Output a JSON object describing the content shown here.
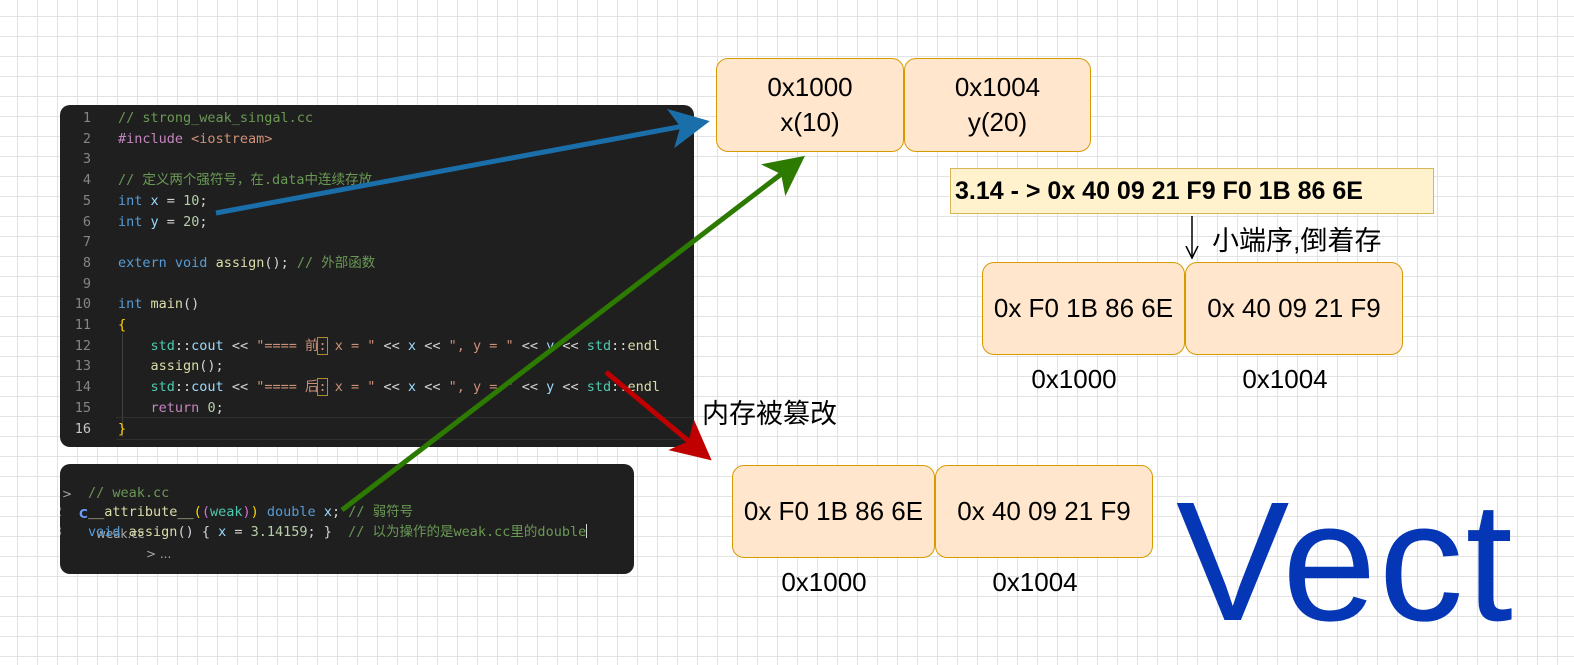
{
  "editor": {
    "lines": [
      {
        "n": "1",
        "tokens": [
          {
            "t": "// strong_weak_singal.cc",
            "c": "comment"
          }
        ]
      },
      {
        "n": "2",
        "tokens": [
          {
            "t": "#include ",
            "c": "pre"
          },
          {
            "t": "<iostream>",
            "c": "str"
          }
        ]
      },
      {
        "n": "3",
        "tokens": []
      },
      {
        "n": "4",
        "tokens": [
          {
            "t": "// 定义两个强符号，在.data中连续存放",
            "c": "comment"
          }
        ]
      },
      {
        "n": "5",
        "tokens": [
          {
            "t": "int",
            "c": "kw"
          },
          {
            "t": " ",
            "c": "punct"
          },
          {
            "t": "x",
            "c": "var"
          },
          {
            "t": " = ",
            "c": "punct"
          },
          {
            "t": "10",
            "c": "num"
          },
          {
            "t": ";",
            "c": "punct"
          }
        ]
      },
      {
        "n": "6",
        "tokens": [
          {
            "t": "int",
            "c": "kw"
          },
          {
            "t": " ",
            "c": "punct"
          },
          {
            "t": "y",
            "c": "var"
          },
          {
            "t": " = ",
            "c": "punct"
          },
          {
            "t": "20",
            "c": "num"
          },
          {
            "t": ";",
            "c": "punct"
          }
        ]
      },
      {
        "n": "7",
        "tokens": []
      },
      {
        "n": "8",
        "tokens": [
          {
            "t": "extern",
            "c": "kw"
          },
          {
            "t": " ",
            "c": "punct"
          },
          {
            "t": "void",
            "c": "kw"
          },
          {
            "t": " ",
            "c": "punct"
          },
          {
            "t": "assign",
            "c": "fn"
          },
          {
            "t": "();",
            "c": "punct"
          },
          {
            "t": " // 外部函数",
            "c": "comment"
          }
        ]
      },
      {
        "n": "9",
        "tokens": []
      },
      {
        "n": "10",
        "tokens": [
          {
            "t": "int",
            "c": "kw"
          },
          {
            "t": " ",
            "c": "punct"
          },
          {
            "t": "main",
            "c": "fn"
          },
          {
            "t": "()",
            "c": "punct"
          }
        ]
      },
      {
        "n": "11",
        "tokens": [
          {
            "t": "{",
            "c": "brace"
          }
        ]
      },
      {
        "n": "12",
        "tokens": [
          {
            "t": "    ",
            "c": "punct"
          },
          {
            "t": "std",
            "c": "ns"
          },
          {
            "t": "::",
            "c": "punct"
          },
          {
            "t": "cout",
            "c": "var"
          },
          {
            "t": " << ",
            "c": "punct"
          },
          {
            "t": "\"==== 前",
            "c": "str"
          },
          {
            "t": ":",
            "c": "strbox"
          },
          {
            "t": " x = \"",
            "c": "str"
          },
          {
            "t": " << ",
            "c": "punct"
          },
          {
            "t": "x",
            "c": "var"
          },
          {
            "t": " << ",
            "c": "punct"
          },
          {
            "t": "\", y = \"",
            "c": "str"
          },
          {
            "t": " << ",
            "c": "punct"
          },
          {
            "t": "y",
            "c": "var"
          },
          {
            "t": " << ",
            "c": "punct"
          },
          {
            "t": "std",
            "c": "ns"
          },
          {
            "t": "::",
            "c": "punct"
          },
          {
            "t": "endl",
            "c": "fn"
          }
        ]
      },
      {
        "n": "13",
        "tokens": [
          {
            "t": "    ",
            "c": "punct"
          },
          {
            "t": "assign",
            "c": "fn"
          },
          {
            "t": "();",
            "c": "punct"
          }
        ]
      },
      {
        "n": "14",
        "tokens": [
          {
            "t": "    ",
            "c": "punct"
          },
          {
            "t": "std",
            "c": "ns"
          },
          {
            "t": "::",
            "c": "punct"
          },
          {
            "t": "cout",
            "c": "var"
          },
          {
            "t": " << ",
            "c": "punct"
          },
          {
            "t": "\"==== 后",
            "c": "str"
          },
          {
            "t": ":",
            "c": "strbox"
          },
          {
            "t": " x = \"",
            "c": "str"
          },
          {
            "t": " << ",
            "c": "punct"
          },
          {
            "t": "x",
            "c": "var"
          },
          {
            "t": " << ",
            "c": "punct"
          },
          {
            "t": "\", y = \"",
            "c": "str"
          },
          {
            "t": " << ",
            "c": "punct"
          },
          {
            "t": "y",
            "c": "var"
          },
          {
            "t": " << ",
            "c": "punct"
          },
          {
            "t": "std",
            "c": "ns"
          },
          {
            "t": "::",
            "c": "punct"
          },
          {
            "t": "endl",
            "c": "fn"
          }
        ]
      },
      {
        "n": "15",
        "tokens": [
          {
            "t": "    ",
            "c": "punct"
          },
          {
            "t": "return",
            "c": "ctrl"
          },
          {
            "t": " ",
            "c": "punct"
          },
          {
            "t": "0",
            "c": "num"
          },
          {
            "t": ";",
            "c": "punct"
          }
        ]
      },
      {
        "n": "16",
        "tokens": [
          {
            "t": "}",
            "c": "brace"
          }
        ]
      }
    ]
  },
  "weak_panel": {
    "breadcrumb_arrow": ">",
    "breadcrumb_file": "weak.cc",
    "breadcrumb_sep": "> ...",
    "lines": [
      {
        "n": "",
        "tokens": [
          {
            "t": "// weak.cc",
            "c": "comment"
          }
        ]
      },
      {
        "n": "2",
        "tokens": [
          {
            "t": "__attribute__",
            "c": "fn"
          },
          {
            "t": "(",
            "c": "paren"
          },
          {
            "t": "(",
            "c": "paren2"
          },
          {
            "t": "weak",
            "c": "ns"
          },
          {
            "t": ")",
            "c": "paren2"
          },
          {
            "t": ")",
            "c": "paren"
          },
          {
            "t": " ",
            "c": "punct"
          },
          {
            "t": "double",
            "c": "kw"
          },
          {
            "t": " ",
            "c": "punct"
          },
          {
            "t": "x",
            "c": "var"
          },
          {
            "t": ";",
            "c": "punct"
          },
          {
            "t": " // 弱符号",
            "c": "comment"
          }
        ]
      },
      {
        "n": "3",
        "tokens": [
          {
            "t": "void",
            "c": "kw"
          },
          {
            "t": " ",
            "c": "punct"
          },
          {
            "t": "assign",
            "c": "fn"
          },
          {
            "t": "() { ",
            "c": "punct"
          },
          {
            "t": "x",
            "c": "var"
          },
          {
            "t": " = ",
            "c": "punct"
          },
          {
            "t": "3.14159",
            "c": "num"
          },
          {
            "t": "; } ",
            "c": "punct"
          },
          {
            "t": " // 以为操作的是weak.cc里的double",
            "c": "comment"
          }
        ]
      }
    ]
  },
  "top_memory": [
    {
      "addr": "0x1000",
      "var": "x(10)"
    },
    {
      "addr": "0x1004",
      "var": "y(20)"
    }
  ],
  "hex_label": "3.14 - > 0x 40 09 21 F9 F0 1B 86 6E",
  "endian_note": "小端序,倒着存",
  "right_memory": {
    "cells": [
      "0x F0 1B 86 6E",
      "0x 40 09 21 F9"
    ],
    "addrs": [
      "0x1000",
      "0x1004"
    ]
  },
  "bottom_memory": {
    "cells": [
      "0x F0 1B 86 6E",
      "0x 40 09 21 F9"
    ],
    "addrs": [
      "0x1000",
      "0x1004"
    ]
  },
  "tamper_note": "内存被篡改",
  "big_text": "Vect",
  "colors": {
    "blue_arrow": "#1a6fab",
    "green_arrow": "#2d7a00",
    "red_arrow": "#c00000",
    "box_fill": "#ffe6cc",
    "box_border": "#d79b00",
    "hex_fill": "#fff2cc",
    "big_text": "#0536b5"
  }
}
